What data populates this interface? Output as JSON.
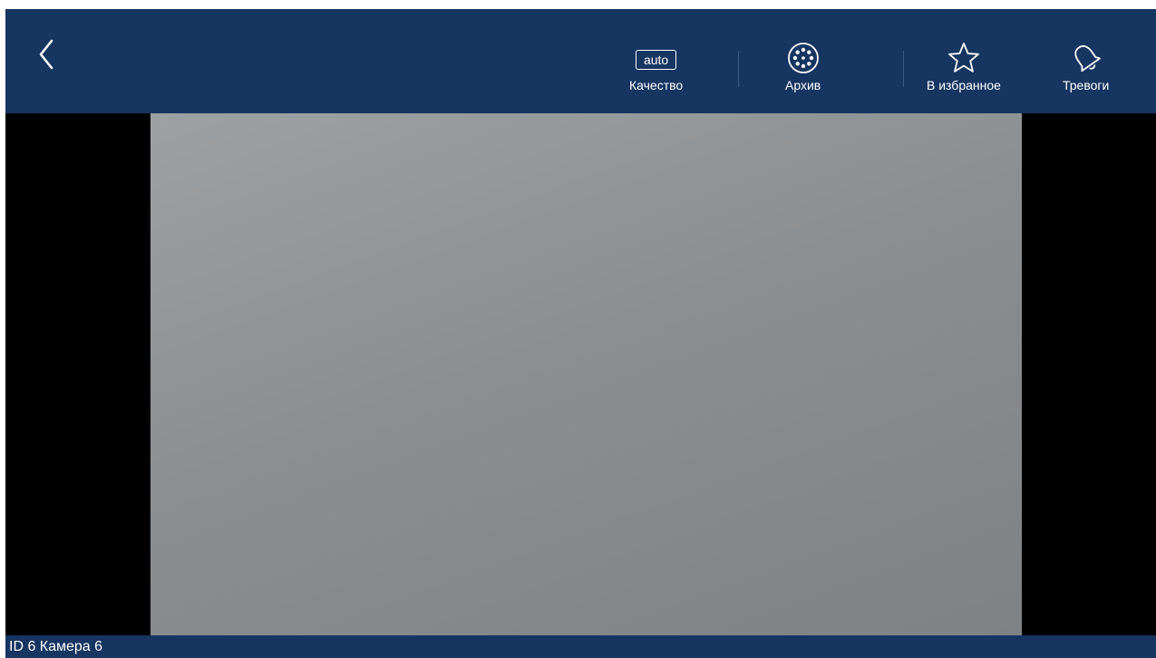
{
  "header": {
    "back_icon": "chevron-left-icon",
    "tools": {
      "quality": {
        "badge": "auto",
        "label": "Качество"
      },
      "archive": {
        "icon": "film-reel-icon",
        "label": "Архив"
      },
      "favorite": {
        "icon": "star-icon",
        "label": "В избранное"
      },
      "alarms": {
        "icon": "bell-icon",
        "label": "Тревоги"
      }
    }
  },
  "footer": {
    "camera_label": "ID 6 Камера 6"
  },
  "colors": {
    "bar": "#163561",
    "background": "#000000",
    "text": "#ffffff"
  }
}
